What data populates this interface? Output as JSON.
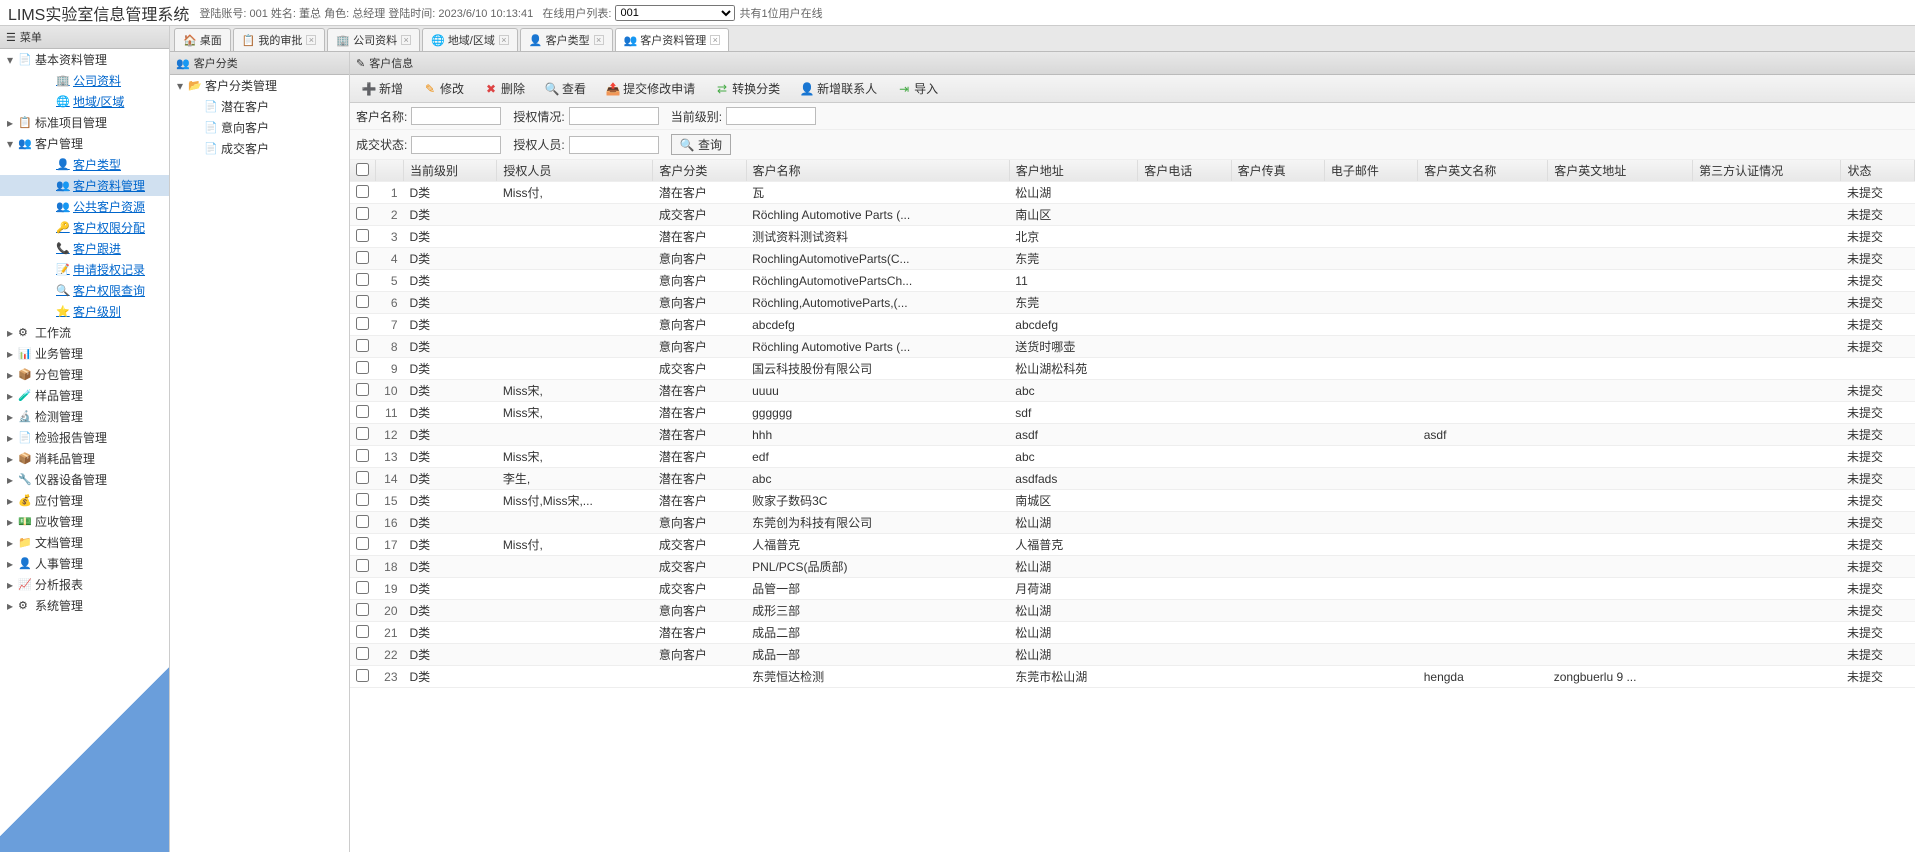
{
  "header": {
    "title": "LIMS实验室信息管理系统",
    "login_label": "登陆账号:",
    "login_val": "001",
    "name_label": "姓名:",
    "name_val": "董总",
    "role_label": "角色:",
    "role_val": "总经理",
    "time_label": "登陆时间:",
    "time_val": "2023/6/10 10:13:41",
    "online_label": "在线用户列表:",
    "online_select": "001",
    "online_count": "共有1位用户在线"
  },
  "menu_title": "菜单",
  "menu": [
    {
      "label": "基本资料管理",
      "exp": "▾",
      "icon": "📄"
    },
    {
      "label": "公司资料",
      "link": true,
      "icon": "🏢"
    },
    {
      "label": "地域/区域",
      "link": true,
      "icon": "🌐"
    },
    {
      "label": "标准项目管理",
      "exp": "▸",
      "icon": "📋",
      "lvl": 1
    },
    {
      "label": "客户管理",
      "exp": "▾",
      "icon": "👥",
      "lvl": 1
    },
    {
      "label": "客户类型",
      "link": true,
      "icon": "👤"
    },
    {
      "label": "客户资料管理",
      "link": true,
      "icon": "👥",
      "selected": true
    },
    {
      "label": "公共客户资源",
      "link": true,
      "icon": "👥"
    },
    {
      "label": "客户权限分配",
      "link": true,
      "icon": "🔑"
    },
    {
      "label": "客户跟进",
      "link": true,
      "icon": "📞"
    },
    {
      "label": "申请授权记录",
      "link": true,
      "icon": "📝"
    },
    {
      "label": "客户权限查询",
      "link": true,
      "icon": "🔍"
    },
    {
      "label": "客户级别",
      "link": true,
      "icon": "⭐"
    },
    {
      "label": "工作流",
      "exp": "▸",
      "icon": "⚙",
      "lvl": 1
    },
    {
      "label": "业务管理",
      "exp": "▸",
      "icon": "📊",
      "lvl": 1
    },
    {
      "label": "分包管理",
      "exp": "▸",
      "icon": "📦",
      "lvl": 1
    },
    {
      "label": "样品管理",
      "exp": "▸",
      "icon": "🧪",
      "lvl": 1
    },
    {
      "label": "检测管理",
      "exp": "▸",
      "icon": "🔬",
      "lvl": 1
    },
    {
      "label": "检验报告管理",
      "exp": "▸",
      "icon": "📄",
      "lvl": 1
    },
    {
      "label": "消耗品管理",
      "exp": "▸",
      "icon": "📦",
      "lvl": 1
    },
    {
      "label": "仪器设备管理",
      "exp": "▸",
      "icon": "🔧",
      "lvl": 1
    },
    {
      "label": "应付管理",
      "exp": "▸",
      "icon": "💰",
      "lvl": 1
    },
    {
      "label": "应收管理",
      "exp": "▸",
      "icon": "💵",
      "lvl": 1
    },
    {
      "label": "文档管理",
      "exp": "▸",
      "icon": "📁",
      "lvl": 1
    },
    {
      "label": "人事管理",
      "exp": "▸",
      "icon": "👤",
      "lvl": 1
    },
    {
      "label": "分析报表",
      "exp": "▸",
      "icon": "📈",
      "lvl": 1
    },
    {
      "label": "系统管理",
      "exp": "▸",
      "icon": "⚙",
      "lvl": 1
    }
  ],
  "tabs": [
    {
      "label": "桌面",
      "icon": "🏠",
      "closable": false
    },
    {
      "label": "我的审批",
      "icon": "📋",
      "closable": true
    },
    {
      "label": "公司资料",
      "icon": "🏢",
      "closable": true
    },
    {
      "label": "地域/区域",
      "icon": "🌐",
      "closable": true
    },
    {
      "label": "客户类型",
      "icon": "👤",
      "closable": true
    },
    {
      "label": "客户资料管理",
      "icon": "👥",
      "closable": true,
      "active": true
    }
  ],
  "cat_panel": {
    "title": "客户分类",
    "root": "客户分类管理",
    "items": [
      "潜在客户",
      "意向客户",
      "成交客户"
    ]
  },
  "info_panel": {
    "title": "客户信息",
    "toolbar": [
      {
        "label": "新增",
        "icon": "➕",
        "cls": "ic-green"
      },
      {
        "label": "修改",
        "icon": "✎",
        "cls": "ic-orange"
      },
      {
        "label": "删除",
        "icon": "✖",
        "cls": "ic-red"
      },
      {
        "label": "查看",
        "icon": "🔍",
        "cls": "ic-blue"
      },
      {
        "label": "提交修改申请",
        "icon": "📤",
        "cls": "ic-blue"
      },
      {
        "label": "转换分类",
        "icon": "⇄",
        "cls": "ic-green"
      },
      {
        "label": "新增联系人",
        "icon": "👤",
        "cls": "ic-blue"
      },
      {
        "label": "导入",
        "icon": "⇥",
        "cls": "ic-green"
      }
    ],
    "search": {
      "f1": "客户名称:",
      "f2": "授权情况:",
      "f3": "当前级别:",
      "f4": "成交状态:",
      "f5": "授权人员:",
      "btn": "查询"
    },
    "columns": [
      "",
      "",
      "当前级别",
      "授权人员",
      "客户分类",
      "客户名称",
      "客户地址",
      "客户电话",
      "客户传真",
      "电子邮件",
      "客户英文名称",
      "客户英文地址",
      "第三方认证情况",
      "状态"
    ],
    "rows": [
      {
        "n": 1,
        "lvl": "D类",
        "auth": "Miss付,",
        "cat": "潜在客户",
        "name": "瓦",
        "addr": "松山湖",
        "stat": "未提交"
      },
      {
        "n": 2,
        "lvl": "D类",
        "auth": "",
        "cat": "成交客户",
        "name": "Röchling Automotive Parts (...",
        "addr": "南山区",
        "stat": "未提交"
      },
      {
        "n": 3,
        "lvl": "D类",
        "auth": "",
        "cat": "潜在客户",
        "name": "测试资料测试资料",
        "addr": "北京",
        "stat": "未提交"
      },
      {
        "n": 4,
        "lvl": "D类",
        "auth": "",
        "cat": "意向客户",
        "name": "RochlingAutomotiveParts(C...",
        "addr": "东莞",
        "stat": "未提交"
      },
      {
        "n": 5,
        "lvl": "D类",
        "auth": "",
        "cat": "意向客户",
        "name": "RöchlingAutomotivePartsCh...",
        "addr": "11",
        "stat": "未提交"
      },
      {
        "n": 6,
        "lvl": "D类",
        "auth": "",
        "cat": "意向客户",
        "name": "Röchling,AutomotiveParts,(...",
        "addr": "东莞",
        "stat": "未提交"
      },
      {
        "n": 7,
        "lvl": "D类",
        "auth": "",
        "cat": "意向客户",
        "name": "abcdefg",
        "addr": "abcdefg",
        "stat": "未提交"
      },
      {
        "n": 8,
        "lvl": "D类",
        "auth": "",
        "cat": "意向客户",
        "name": "Röchling Automotive Parts (...",
        "addr": "送货时哪壶",
        "stat": "未提交"
      },
      {
        "n": 9,
        "lvl": "D类",
        "auth": "",
        "cat": "成交客户",
        "name": "国云科技股份有限公司",
        "addr": "松山湖松科苑",
        "stat": ""
      },
      {
        "n": 10,
        "lvl": "D类",
        "auth": "Miss宋,",
        "cat": "潜在客户",
        "name": "uuuu",
        "addr": "abc",
        "stat": "未提交"
      },
      {
        "n": 11,
        "lvl": "D类",
        "auth": "Miss宋,",
        "cat": "潜在客户",
        "name": "gggggg",
        "addr": "sdf",
        "stat": "未提交"
      },
      {
        "n": 12,
        "lvl": "D类",
        "auth": "",
        "cat": "潜在客户",
        "name": "hhh",
        "addr": "asdf",
        "ename": "asdf",
        "stat": "未提交"
      },
      {
        "n": 13,
        "lvl": "D类",
        "auth": "Miss宋,",
        "cat": "潜在客户",
        "name": "edf",
        "addr": "abc",
        "stat": "未提交"
      },
      {
        "n": 14,
        "lvl": "D类",
        "auth": "李生,",
        "cat": "潜在客户",
        "name": "abc",
        "addr": "asdfads",
        "stat": "未提交"
      },
      {
        "n": 15,
        "lvl": "D类",
        "auth": "Miss付,Miss宋,...",
        "cat": "潜在客户",
        "name": "败家子数码3C",
        "addr": "南城区",
        "stat": "未提交"
      },
      {
        "n": 16,
        "lvl": "D类",
        "auth": "",
        "cat": "意向客户",
        "name": "东莞创为科技有限公司",
        "addr": "松山湖",
        "stat": "未提交"
      },
      {
        "n": 17,
        "lvl": "D类",
        "auth": "Miss付,",
        "cat": "成交客户",
        "name": "人福普克",
        "addr": "人福普克",
        "stat": "未提交"
      },
      {
        "n": 18,
        "lvl": "D类",
        "auth": "",
        "cat": "成交客户",
        "name": "PNL/PCS(品质部)",
        "addr": "松山湖",
        "stat": "未提交"
      },
      {
        "n": 19,
        "lvl": "D类",
        "auth": "",
        "cat": "成交客户",
        "name": "品管一部",
        "addr": "月荷湖",
        "stat": "未提交"
      },
      {
        "n": 20,
        "lvl": "D类",
        "auth": "",
        "cat": "意向客户",
        "name": "成形三部",
        "addr": "松山湖",
        "stat": "未提交"
      },
      {
        "n": 21,
        "lvl": "D类",
        "auth": "",
        "cat": "潜在客户",
        "name": "成品二部",
        "addr": "松山湖",
        "stat": "未提交"
      },
      {
        "n": 22,
        "lvl": "D类",
        "auth": "",
        "cat": "意向客户",
        "name": "成品一部",
        "addr": "松山湖",
        "stat": "未提交"
      },
      {
        "n": 23,
        "lvl": "D类",
        "auth": "",
        "cat": "",
        "name": "东莞恒达检测",
        "addr": "东莞市松山湖",
        "ename": "hengda",
        "eaddr": "zongbuerlu 9 ...",
        "stat": "未提交"
      }
    ]
  }
}
